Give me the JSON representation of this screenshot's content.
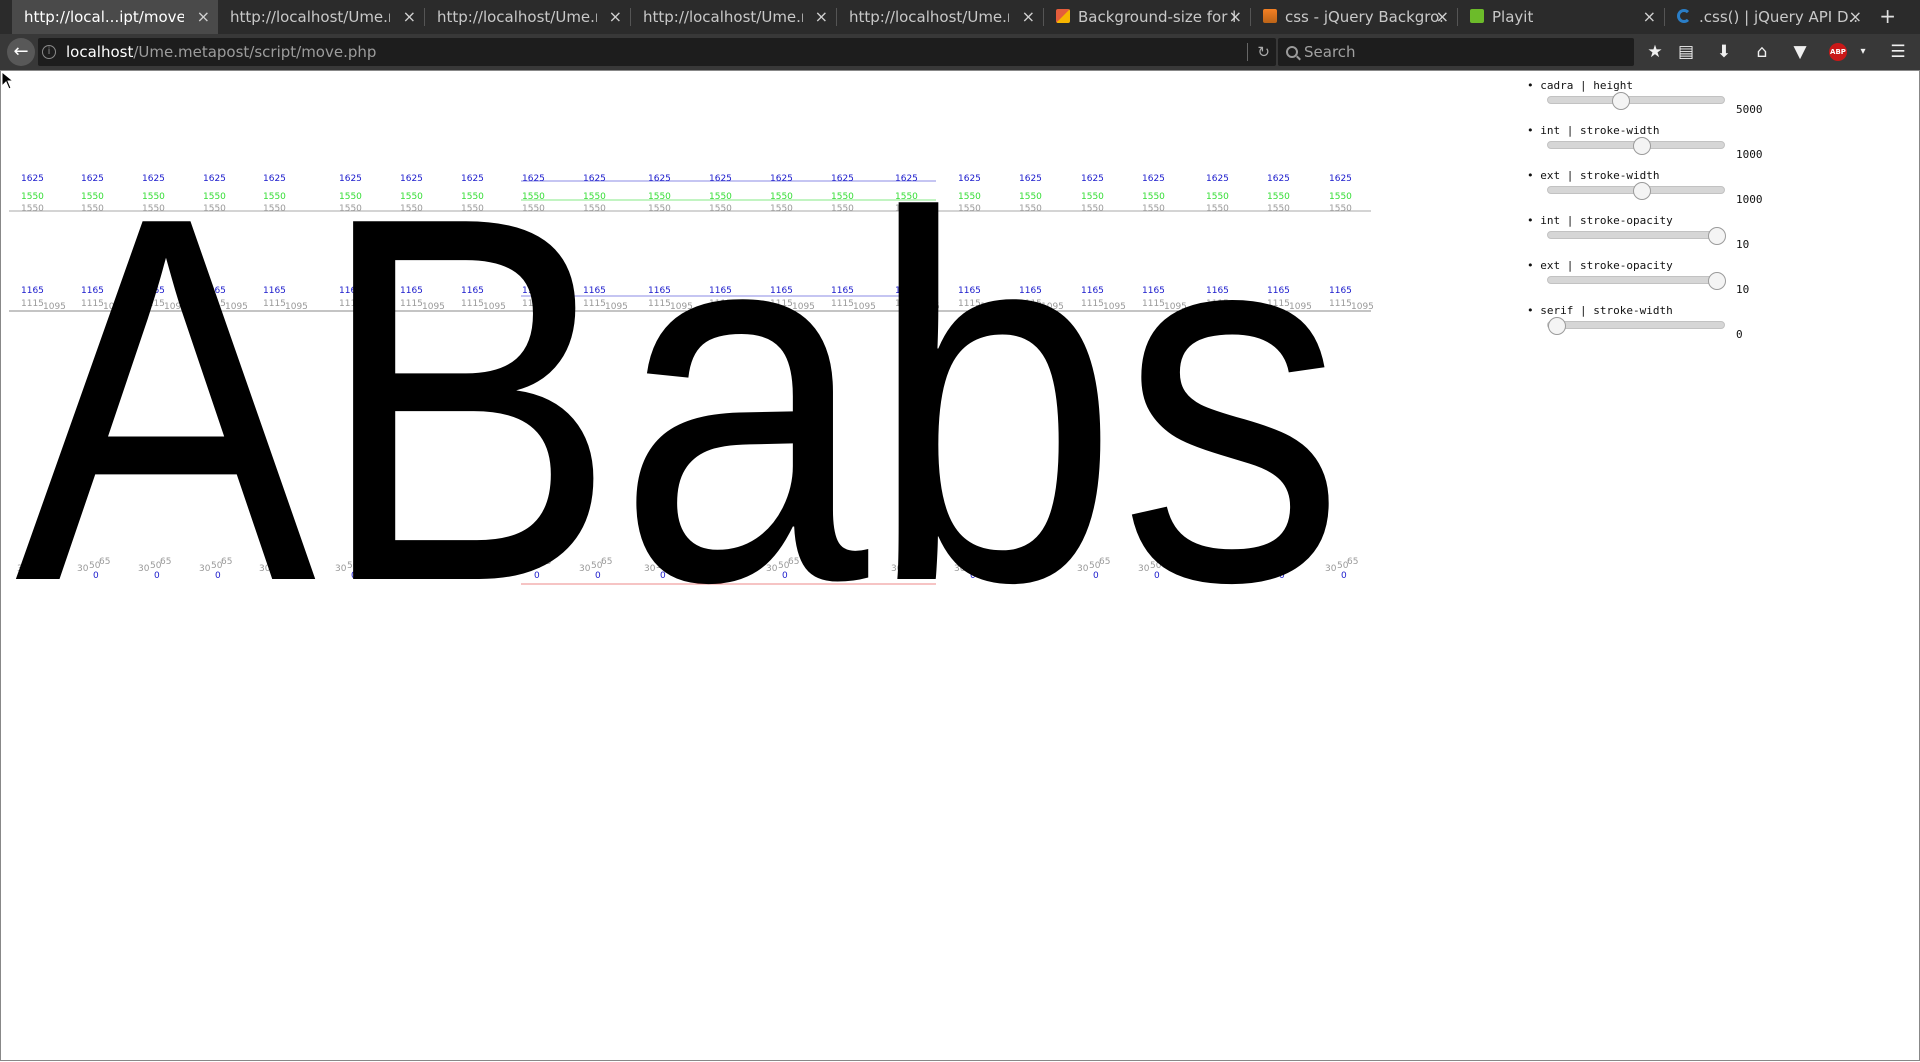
{
  "browser": {
    "tabs": [
      {
        "title": "http://local...ipt/move.php",
        "favicon": "none",
        "active": true
      },
      {
        "title": "http://localhost/Ume.me...",
        "favicon": "none",
        "active": false
      },
      {
        "title": "http://localhost/Ume.me...",
        "favicon": "none",
        "active": false
      },
      {
        "title": "http://localhost/Ume.me...",
        "favicon": "none",
        "active": false
      },
      {
        "title": "http://localhost/Ume.me...",
        "favicon": "none",
        "active": false
      },
      {
        "title": "Background-size for l...",
        "favicon": "brush-icon",
        "active": false
      },
      {
        "title": "css - jQuery Backgro...",
        "favicon": "stackoverflow-icon",
        "active": false
      },
      {
        "title": "Playit",
        "favicon": "playit-icon",
        "active": false
      },
      {
        "title": ".css() | jQuery API D...",
        "favicon": "jquery-icon",
        "active": false
      }
    ],
    "url_host": "localhost",
    "url_path": "/Ume.metapost/script/move.php",
    "search_placeholder": "Search",
    "abp_label": "ABP"
  },
  "glyph_text": "ABabs",
  "metrics": {
    "label_1625": "1625",
    "label_1550": "1550",
    "label_1165": "1165",
    "label_1115": "1115",
    "label_1095": "1095",
    "label_30": "30",
    "label_50": "50",
    "label_65": "65",
    "label_0": "0",
    "colors": {
      "blue": "#1a1acc",
      "green": "#33dd33",
      "gray": "#999999",
      "black": "#000000",
      "red": "#ee8888"
    }
  },
  "controls": [
    {
      "label": "cadra | height",
      "value": "5000",
      "fraction": 0.4
    },
    {
      "label": "int | stroke-width",
      "value": "1000",
      "fraction": 0.53
    },
    {
      "label": "ext | stroke-width",
      "value": "1000",
      "fraction": 0.53
    },
    {
      "label": "int | stroke-opacity",
      "value": "10",
      "fraction": 1.0
    },
    {
      "label": "ext | stroke-opacity",
      "value": "10",
      "fraction": 1.0
    },
    {
      "label": "serif | stroke-width",
      "value": "0",
      "fraction": 0.0
    }
  ]
}
